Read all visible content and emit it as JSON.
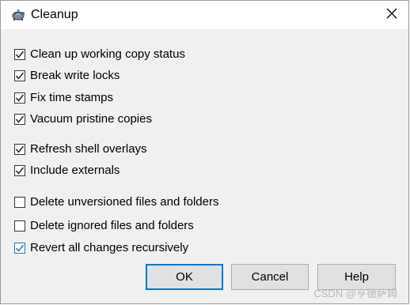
{
  "window": {
    "title": "Cleanup",
    "icon": "tortoisesvn-app-icon",
    "close_icon": "close-icon"
  },
  "options": [
    {
      "id": "clean-up-working-copy-status",
      "label": "Clean up working copy status",
      "checked": true
    },
    {
      "id": "break-write-locks",
      "label": "Break write locks",
      "checked": true
    },
    {
      "id": "fix-time-stamps",
      "label": "Fix time stamps",
      "checked": true
    },
    {
      "id": "vacuum-pristine-copies",
      "label": "Vacuum pristine copies",
      "checked": true
    },
    {
      "id": "refresh-shell-overlays",
      "label": "Refresh shell overlays",
      "checked": true
    },
    {
      "id": "include-externals",
      "label": "Include externals",
      "checked": true
    },
    {
      "id": "delete-unversioned",
      "label": "Delete unversioned files and folders",
      "checked": false
    },
    {
      "id": "delete-ignored",
      "label": "Delete ignored files and folders",
      "checked": false
    },
    {
      "id": "revert-all-changes",
      "label": "Revert all changes recursively",
      "checked": true
    }
  ],
  "buttons": {
    "ok": "OK",
    "cancel": "Cancel",
    "help": "Help"
  },
  "watermark": "CSDN @亨德萨姆",
  "colors": {
    "accent": "#0078d7",
    "dialog_bg": "#f0f0f0",
    "title_bg": "#ffffff"
  }
}
